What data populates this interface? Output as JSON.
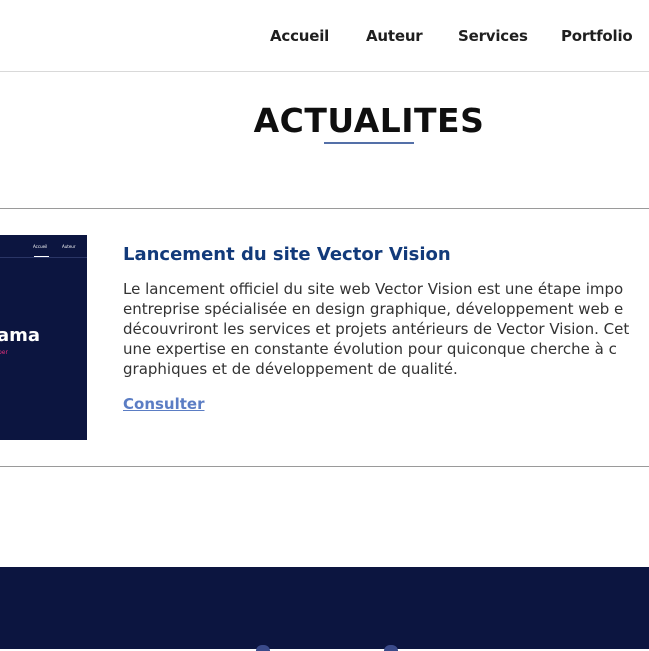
{
  "nav": {
    "items": [
      "Accueil",
      "Auteur",
      "Services",
      "Portfolio"
    ]
  },
  "page": {
    "title": "ACTUALITES"
  },
  "article": {
    "thumbnail": {
      "nav_items": [
        "Accueil",
        "Auteur"
      ],
      "headline_fragment": "ama",
      "subline_fragment": "per"
    },
    "title": "Lancement du site Vector Vision",
    "body_lines": [
      "Le lancement officiel du site web Vector Vision est une étape impo",
      "entreprise spécialisée en design graphique, développement web e",
      "découvriront les services et projets antérieurs de Vector Vision. Cet",
      "une expertise en constante évolution pour quiconque cherche à c",
      "graphiques et de développement de qualité."
    ],
    "link_label": "Consulter"
  },
  "colors": {
    "accent": "#5470a8",
    "title": "#123a7a",
    "link": "#5b7dc4",
    "footer": "#0c1540",
    "thumb_accent": "#e0307a"
  }
}
